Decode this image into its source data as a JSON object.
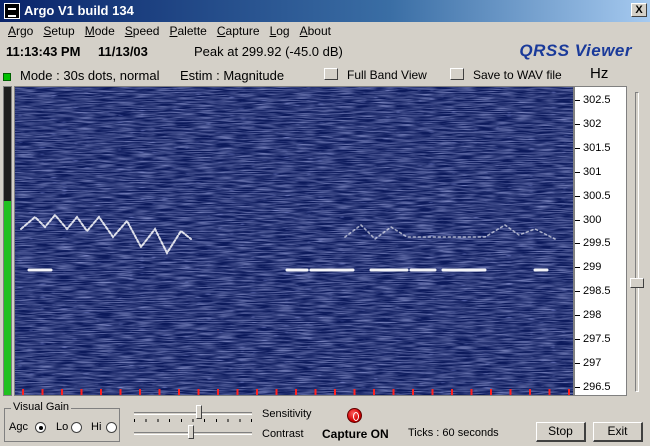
{
  "window": {
    "title": "Argo V1 build 134",
    "close_glyph": "X",
    "icon": "app-icon"
  },
  "menu": [
    "Argo",
    "Setup",
    "Mode",
    "Speed",
    "Palette",
    "Capture",
    "Log",
    "About"
  ],
  "info": {
    "time": "11:13:43 PM",
    "date": "11/13/03",
    "peak": "Peak at 299.92 (-45.0 dB)",
    "brand": "QRSS Viewer"
  },
  "mode_row": {
    "mode": "Mode : 30s dots, normal",
    "estim": "Estim : Magnitude",
    "full_band_label": "Full Band View",
    "save_wav_label": "Save to WAV file",
    "unit": "Hz"
  },
  "scale_labels": [
    "302.5",
    "302",
    "301.5",
    "301",
    "300.5",
    "300",
    "299.5",
    "299",
    "298.5",
    "298",
    "297.5",
    "297",
    "296.5"
  ],
  "colors": {
    "waterfall_bg": "#0c1a5c",
    "signal": "#ffffff",
    "time_ticks": "#ff2020",
    "agc_green": "#20c020"
  },
  "left_level": 0.63,
  "right_slider_position": 0.64,
  "bottom": {
    "gain_title": "Visual Gain",
    "gain_options": [
      "Agc",
      "Lo",
      "Hi"
    ],
    "gain_selected": "Agc",
    "sensitivity_label": "Sensitivity",
    "contrast_label": "Contrast",
    "sensitivity_value": 0.55,
    "contrast_value": 0.48,
    "capture_status": "Capture ON",
    "ticks": "Ticks  : 60 seconds",
    "stop_label": "Stop",
    "exit_label": "Exit"
  }
}
